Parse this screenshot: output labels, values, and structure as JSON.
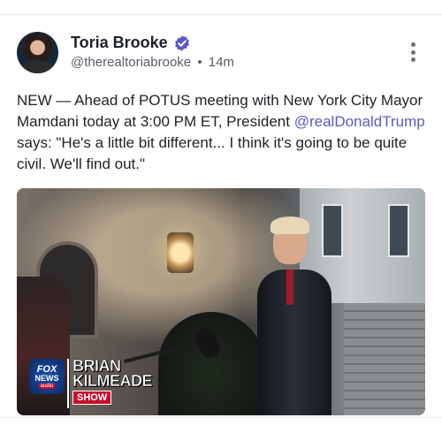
{
  "post": {
    "author": {
      "display_name": "Toria Brooke",
      "handle": "@therealtoriabrooke",
      "verified": true,
      "verified_color": "#5a58c9",
      "avatar_icon": "profile-photo"
    },
    "timestamp": "14m",
    "meta_separator": "•",
    "more_icon": "vertical-ellipsis-icon",
    "text_before_mention": "NEW — Ahead of POTUS meeting with New York City Mayor Mamdani today at 3:00 PM ET, President ",
    "mention": "@realDonaldTrump",
    "text_after_mention": " says: \"He's a little bit different... I think it's going to be quite civil. We'll find out.\"",
    "mention_color": "#5a58c9",
    "media": {
      "kind": "photo",
      "overlay_logo": {
        "brand_line1": "FOX",
        "brand_line2": "NEWS",
        "brand_line3": "audio",
        "show_line1": "BRIAN",
        "show_line2": "KILMEADE",
        "show_tag": "SHOW"
      }
    }
  }
}
